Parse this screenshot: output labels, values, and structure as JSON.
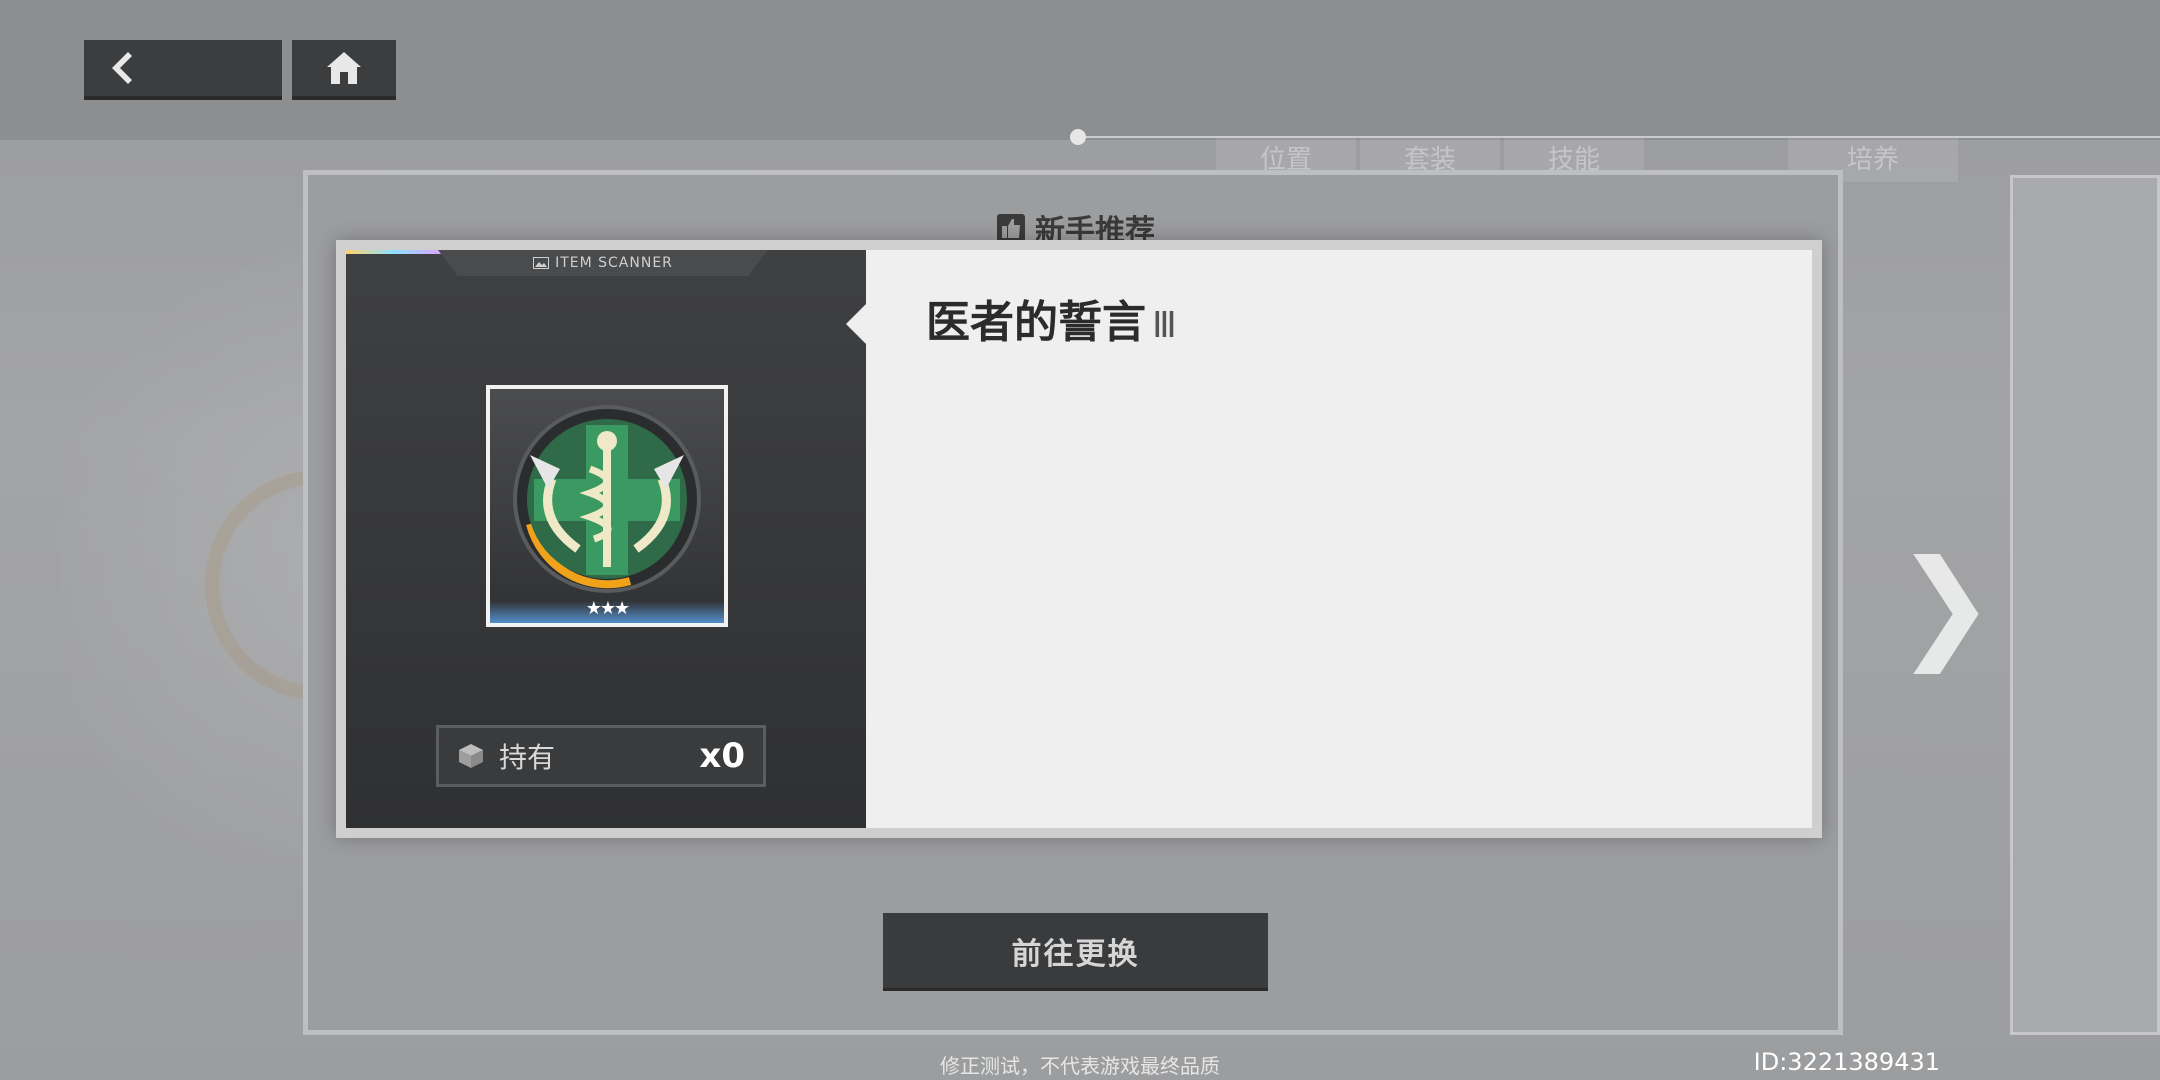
{
  "background": {
    "tabs": [
      "位置",
      "套装",
      "技能",
      "培养"
    ]
  },
  "nav": {
    "back_icon": "chevron-left-icon",
    "home_icon": "home-icon"
  },
  "modal": {
    "title": "新手推荐",
    "title_icon": "thumbs-up-icon"
  },
  "item": {
    "scanner_label": "ITEM SCANNER",
    "name": "医者的誓言",
    "tier": "Ⅲ",
    "stars": "★★★",
    "own_label": "持有",
    "own_count": "x0"
  },
  "action": {
    "label": "前往更换"
  },
  "footer": {
    "note": "修正测试，不代表游戏最终品质",
    "uid": "ID:3221389431"
  },
  "colors": {
    "card_right_bg": "#efefef",
    "card_left_bg": "#353638",
    "button_bg": "#3a3b3d",
    "badge_green": "#2f8a55",
    "badge_gold": "#f0a21b"
  }
}
